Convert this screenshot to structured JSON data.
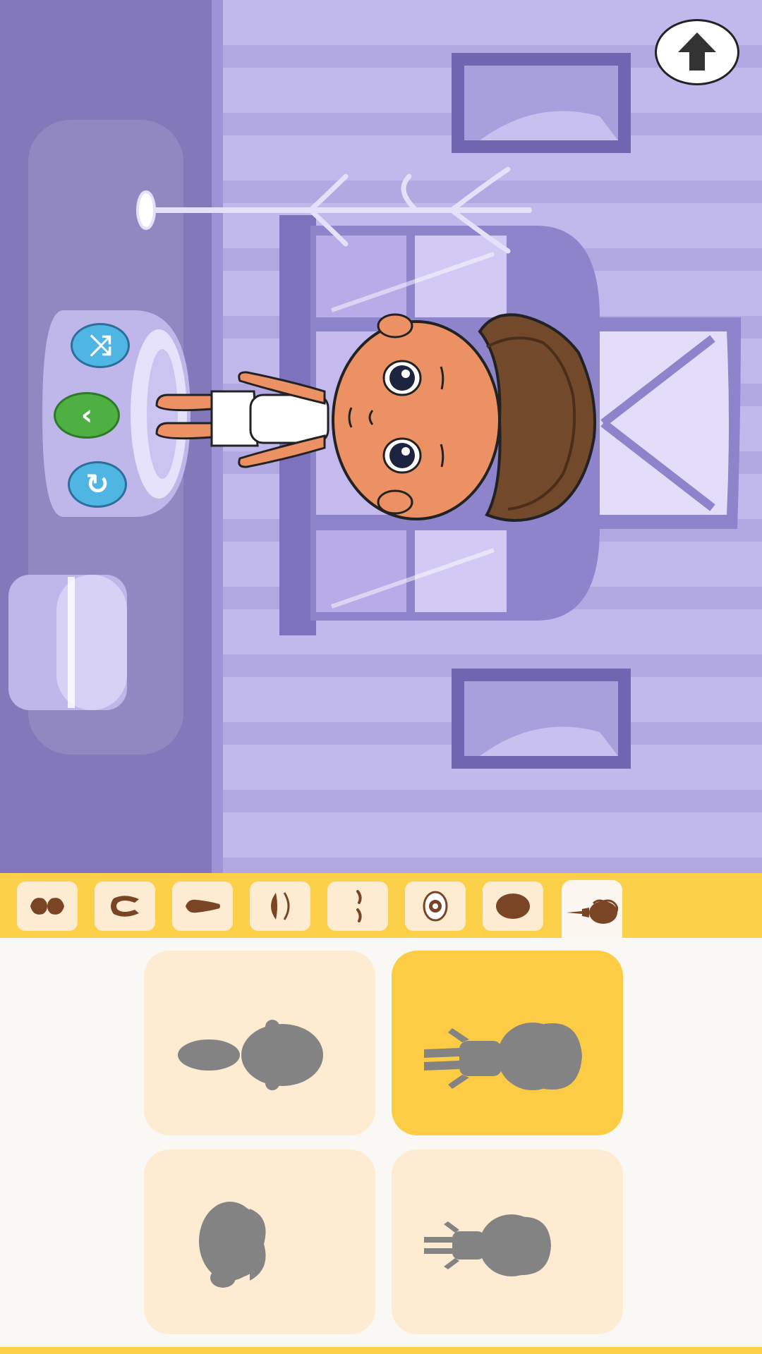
{
  "app": {
    "screen": "character-creator",
    "palette": {
      "wall": "#c1b8ec",
      "floor": "#8378b9",
      "accent_yellow": "#fdd04a",
      "card": "#fdecd2",
      "card_selected": "#fdcc45",
      "silhouette": "#838383",
      "part_icon": "#7a4524"
    }
  },
  "scene": {
    "buttons": [
      {
        "id": "upload",
        "icon": "arrow-up-icon"
      },
      {
        "id": "random",
        "icon": "shuffle-icon"
      },
      {
        "id": "back",
        "icon": "chevron-left-icon"
      },
      {
        "id": "reset",
        "icon": "rotate-icon"
      }
    ]
  },
  "tabs": [
    {
      "id": "mustache",
      "icon": "mustache-icon",
      "active": false
    },
    {
      "id": "ears",
      "icon": "ear-icon",
      "active": false
    },
    {
      "id": "nose",
      "icon": "nose-icon",
      "active": false
    },
    {
      "id": "mouth",
      "icon": "mouth-icon",
      "active": false
    },
    {
      "id": "eyebrows",
      "icon": "eyebrow-icon",
      "active": false
    },
    {
      "id": "eyes",
      "icon": "eye-icon",
      "active": false
    },
    {
      "id": "face",
      "icon": "face-shape-icon",
      "active": false
    },
    {
      "id": "body",
      "icon": "body-icon",
      "active": true
    }
  ],
  "options": [
    {
      "id": "body-1",
      "icon": "baby-silhouette-icon",
      "selected": false
    },
    {
      "id": "body-2",
      "icon": "child-silhouette-icon",
      "selected": true
    },
    {
      "id": "body-3",
      "icon": "toddler-silhouette-icon",
      "selected": false
    },
    {
      "id": "body-4",
      "icon": "small-child-silhouette-icon",
      "selected": false
    }
  ]
}
